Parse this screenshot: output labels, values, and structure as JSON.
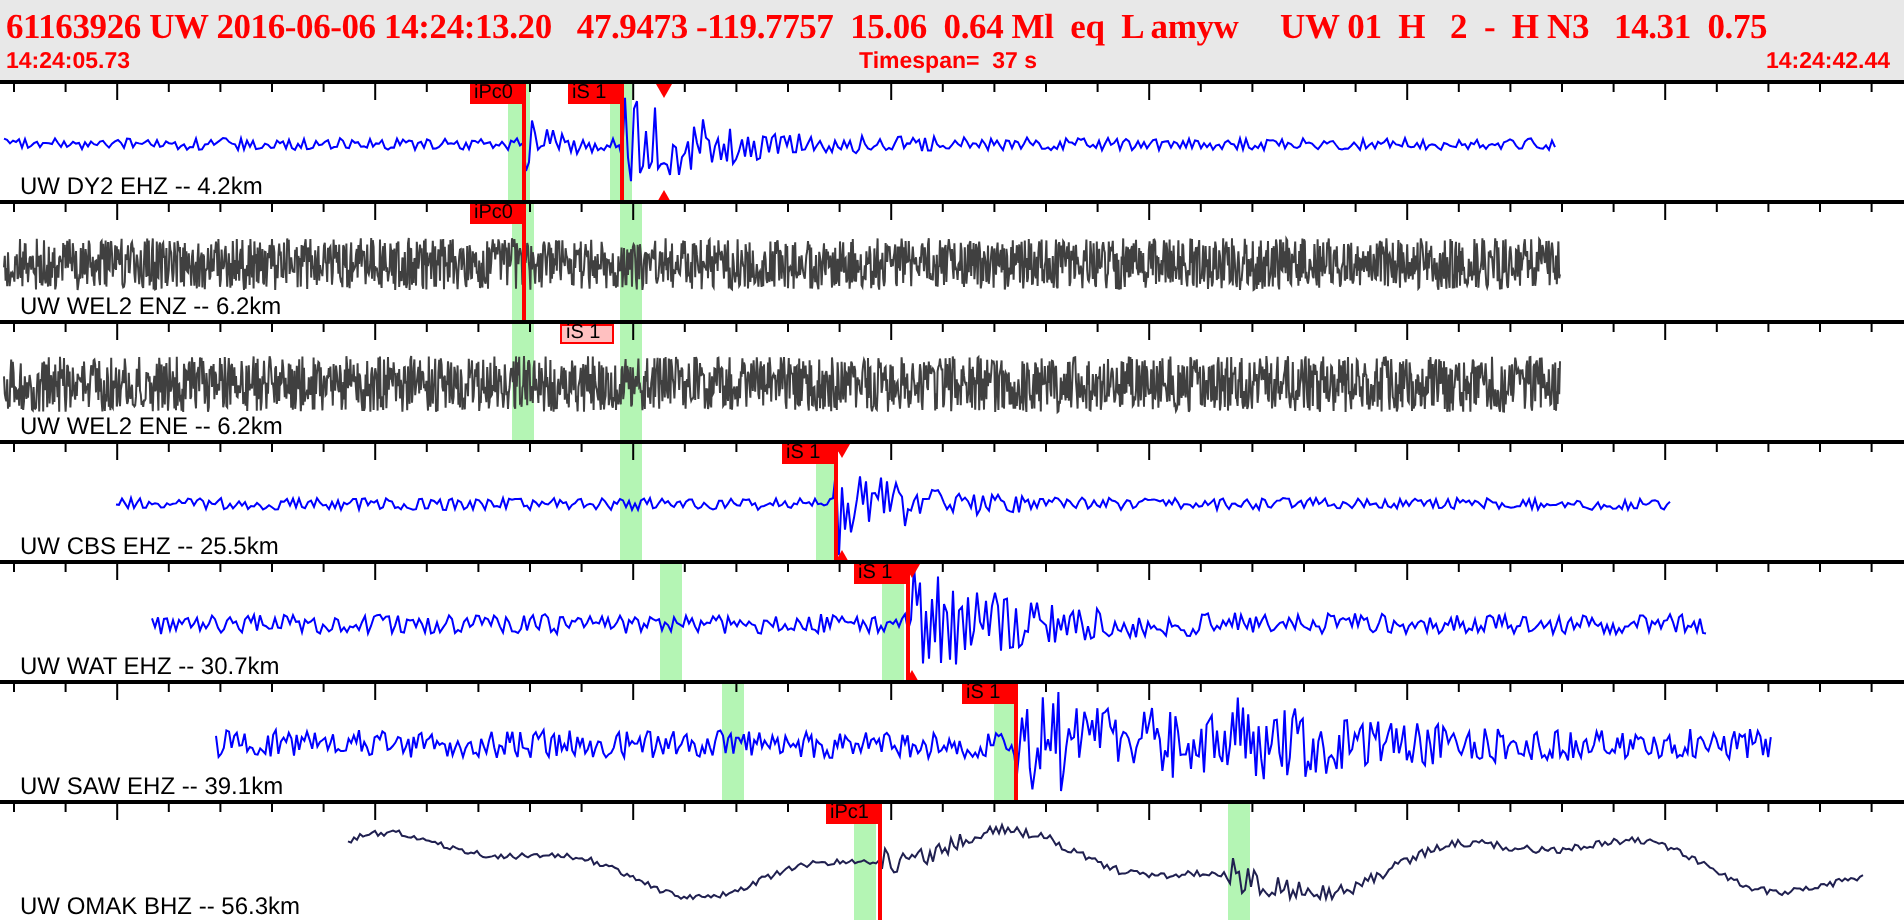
{
  "event": {
    "summary": "61163926 UW 2016-06-06 14:24:13.20   47.9473 -119.7757  15.06  0.64 Ml  eq  L amyw     UW 01  H   2  -  H N3   14.31  0.75",
    "start_time": "14:24:05.73",
    "timespan": "Timespan=  37 s",
    "end_time": "14:24:42.44"
  },
  "traces": [
    {
      "label": "UW DY2 EHZ -- 4.2km",
      "picks": [
        {
          "label": "iPc0",
          "faded": false
        },
        {
          "label": "iS 1",
          "faded": false
        }
      ]
    },
    {
      "label": "UW WEL2 ENZ -- 6.2km",
      "picks": [
        {
          "label": "iPc0",
          "faded": false
        }
      ]
    },
    {
      "label": "UW WEL2 ENE -- 6.2km",
      "picks": [
        {
          "label": "iS 1",
          "faded": true
        }
      ]
    },
    {
      "label": "UW CBS EHZ -- 25.5km",
      "picks": [
        {
          "label": "iS 1",
          "faded": false
        }
      ]
    },
    {
      "label": "UW WAT EHZ -- 30.7km",
      "picks": [
        {
          "label": "iS 1",
          "faded": false
        }
      ]
    },
    {
      "label": "UW SAW EHZ -- 39.1km",
      "picks": [
        {
          "label": "iS 1",
          "faded": false
        }
      ]
    },
    {
      "label": "UW OMAK BHZ -- 56.3km",
      "picks": [
        {
          "label": "iPc1",
          "faded": false
        }
      ]
    }
  ]
}
